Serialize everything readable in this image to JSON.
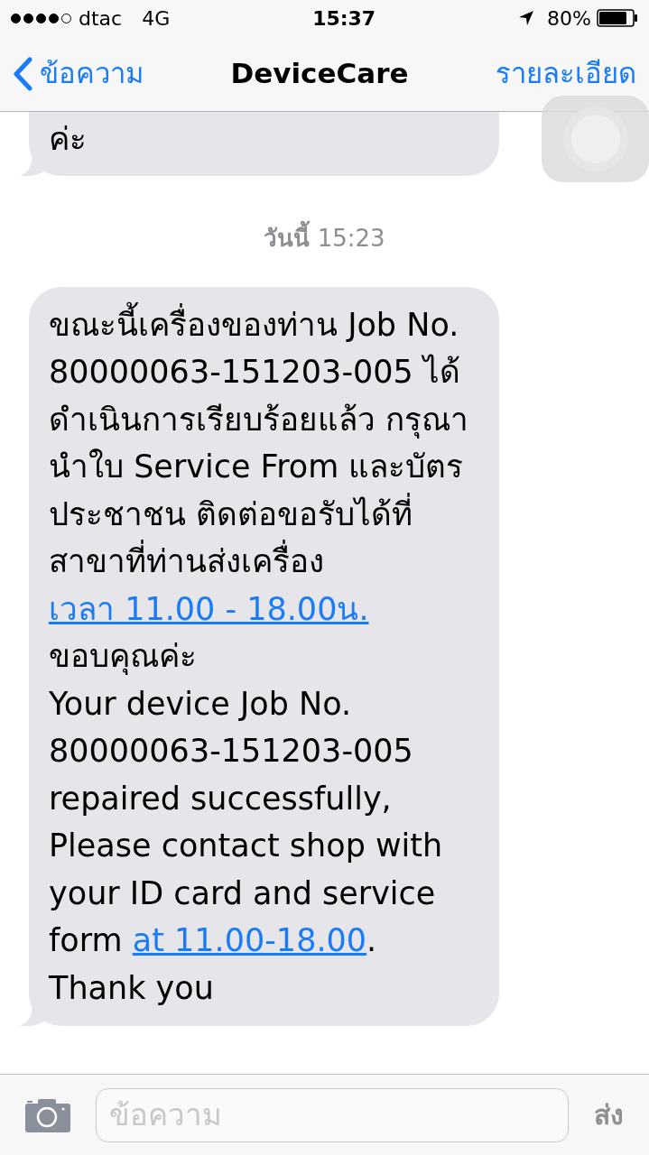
{
  "status_bar": {
    "carrier": "dtac",
    "network": "4G",
    "time": "15:37",
    "battery": "80%"
  },
  "nav_bar": {
    "back": "ข้อความ",
    "title": "DeviceCare",
    "details": "รายละเอียด"
  },
  "messages": [
    {
      "kind": "bubble",
      "paragraphs": [
        [
          {
            "text": "ค่ะ",
            "link": false
          }
        ]
      ]
    },
    {
      "kind": "timestamp",
      "day": "วันนี้",
      "time": "15:23"
    },
    {
      "kind": "bubble",
      "paragraphs": [
        [
          {
            "text": "ขณะนี้เครื่องของท่าน Job No. 80000063-151203-005 ได้ดำเนินการเรียบร้อยแล้ว กรุณานำใบ Service From และบัตรประชาชน ติดต่อขอรับได้ที่สาขาที่ท่านส่งเครื่อง ",
            "link": false
          },
          {
            "text": "เวลา 11.00 - 18.00น.",
            "link": true
          },
          {
            "text": " ขอบคุณค่ะ",
            "link": false
          }
        ],
        [
          {
            "text": "Your device Job No. 80000063-151203-005 repaired successfully, Please contact shop with your ID card and service form ",
            "link": false
          },
          {
            "text": "at 11.00-18.00",
            "link": true
          },
          {
            "text": ". Thank you",
            "link": false
          }
        ]
      ]
    }
  ],
  "input_bar": {
    "placeholder": "ข้อความ",
    "send": "ส่ง"
  }
}
